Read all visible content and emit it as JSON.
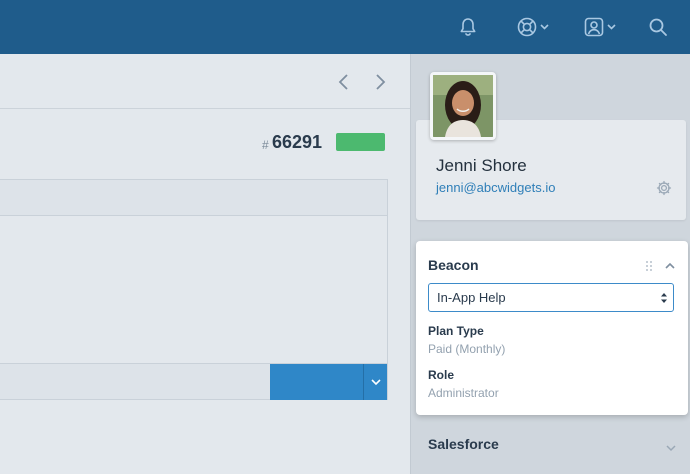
{
  "topbar": {
    "icons": [
      "bell-icon",
      "lifebuoy-icon",
      "user-card-icon",
      "search-icon"
    ],
    "background": "#1f5c8b"
  },
  "ticket": {
    "hash": "#",
    "number": "66291",
    "status_color": "#4cb96f"
  },
  "customer": {
    "name": "Jenni Shore",
    "email": "jenni@abcwidgets.io"
  },
  "beacon": {
    "title": "Beacon",
    "selected_option": "In-App Help",
    "fields": [
      {
        "label": "Plan Type",
        "value": "Paid (Monthly)"
      },
      {
        "label": "Role",
        "value": "Administrator"
      }
    ]
  },
  "salesforce": {
    "title": "Salesforce"
  },
  "colors": {
    "accent": "#2f87c8",
    "link": "#2f7fb8",
    "success": "#4cb96f"
  }
}
